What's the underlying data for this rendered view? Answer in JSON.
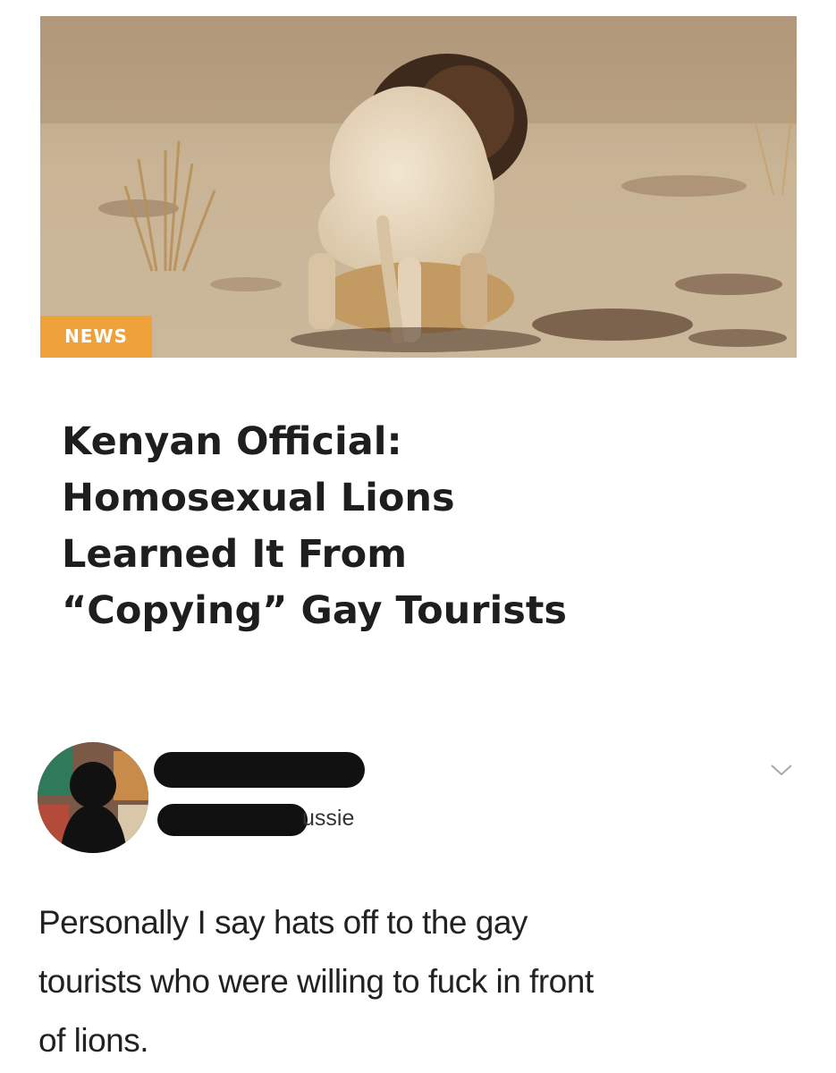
{
  "article": {
    "badge": "NEWS",
    "headline_lines": [
      "Kenyan Official:",
      "Homosexual Lions",
      "Learned It From",
      "“Copying” Gay Tourists"
    ]
  },
  "comment": {
    "handle_visible_suffix": "ussie",
    "text_lines": [
      "Personally I say hats off to the gay",
      "tourists who were willing to fuck in front",
      "of lions."
    ],
    "more_icon": "chevron-down-icon"
  },
  "colors": {
    "badge": "#f0a23a",
    "headline": "#1e1e1e",
    "redaction": "#111111"
  }
}
